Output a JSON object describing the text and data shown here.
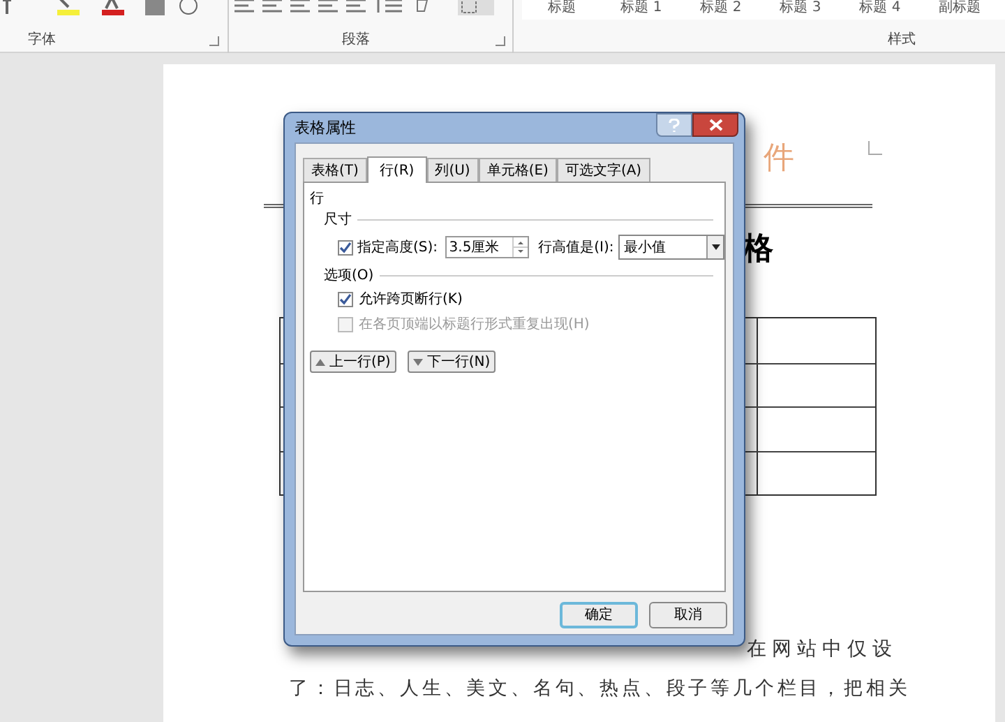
{
  "ribbon": {
    "groups": [
      {
        "label": "字体"
      },
      {
        "label": "段落"
      },
      {
        "label": "样式"
      }
    ],
    "styles": [
      "标题",
      "标题 1",
      "标题 2",
      "标题 3",
      "标题 4",
      "副标题"
    ]
  },
  "document": {
    "title_fragment": "件",
    "heading_fragment": "格",
    "paragraph_lines": [
      "在网站中仅设",
      "了：日志、人生、美文、名句、热点、段子等几个栏目，把相关"
    ]
  },
  "dialog": {
    "title": "表格属性",
    "tabs": [
      {
        "label": "表格(T)",
        "selected": false
      },
      {
        "label": "行(R)",
        "selected": true
      },
      {
        "label": "列(U)",
        "selected": false
      },
      {
        "label": "单元格(E)",
        "selected": false
      },
      {
        "label": "可选文字(A)",
        "selected": false
      }
    ],
    "section": "行",
    "size_group": "尺寸",
    "specify_height": {
      "label": "指定高度(S):",
      "checked": true,
      "value": "3.5厘米"
    },
    "height_mode": {
      "label": "行高值是(I):",
      "value": "最小值"
    },
    "options_group": "选项(O)",
    "options": [
      {
        "label": "允许跨页断行(K)",
        "checked": true,
        "disabled": false
      },
      {
        "label": "在各页顶端以标题行形式重复出现(H)",
        "checked": false,
        "disabled": true
      }
    ],
    "nav_buttons": [
      "上一行(P)",
      "下一行(N)"
    ],
    "buttons": [
      {
        "label": "确定",
        "default": true
      },
      {
        "label": "取消",
        "default": false
      }
    ]
  }
}
